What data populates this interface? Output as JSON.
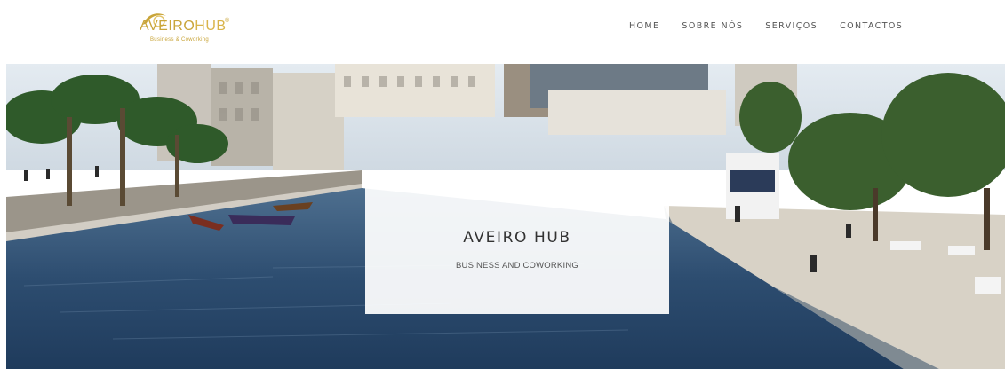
{
  "header": {
    "logo": {
      "word_main": "AVEIRO",
      "word_hub": "HUB",
      "registered": "®",
      "tagline": "Business & Coworking"
    },
    "nav": [
      {
        "label": "HOME"
      },
      {
        "label": "SOBRE NÓS"
      },
      {
        "label": "SERVIÇOS"
      },
      {
        "label": "CONTACTOS"
      }
    ]
  },
  "hero": {
    "image": "aveiro-canal-photo",
    "title": "AVEIRO HUB",
    "subtitle": "BUSINESS AND COWORKING"
  },
  "colors": {
    "brand_gold": "#c9a53a",
    "nav_text": "#555555",
    "water": "#2f4f72",
    "sky": "#dfe6ec"
  }
}
